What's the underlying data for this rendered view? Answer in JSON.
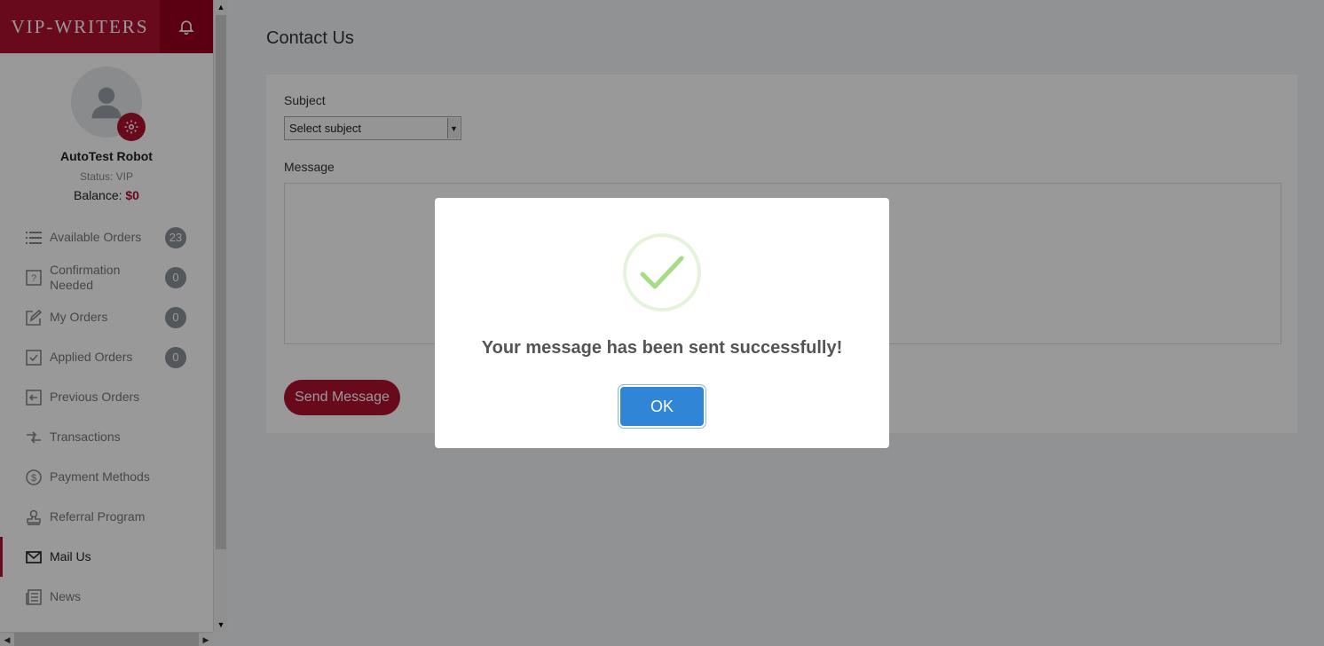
{
  "brand": {
    "logo": "VIP-WRITERS",
    "accent": "#b0112f"
  },
  "profile": {
    "name": "AutoTest Robot",
    "status": "Status: VIP",
    "balance_label": "Balance:",
    "balance_value": "$0"
  },
  "sidebar": {
    "items": [
      {
        "label": "Available Orders",
        "icon": "list-icon",
        "badge": "23"
      },
      {
        "label": "Confirmation Needed",
        "icon": "question-icon",
        "badge": "0"
      },
      {
        "label": "My Orders",
        "icon": "edit-icon",
        "badge": "0"
      },
      {
        "label": "Applied Orders",
        "icon": "checkbox-icon",
        "badge": "0"
      },
      {
        "label": "Previous Orders",
        "icon": "arrow-left-box-icon"
      },
      {
        "label": "Transactions",
        "icon": "transfer-icon"
      },
      {
        "label": "Payment Methods",
        "icon": "dollar-circle-icon"
      },
      {
        "label": "Referral Program",
        "icon": "stamp-icon"
      },
      {
        "label": "Mail Us",
        "icon": "envelope-icon",
        "active": true
      },
      {
        "label": "News",
        "icon": "newspaper-icon"
      }
    ]
  },
  "main": {
    "title": "Contact Us",
    "subject_label": "Subject",
    "subject_value": "Select subject",
    "message_label": "Message",
    "send_label": "Send Message"
  },
  "modal": {
    "message": "Your message has been sent successfully!",
    "ok_label": "OK",
    "success_color": "#a5dc86",
    "button_color": "#3085d6"
  }
}
